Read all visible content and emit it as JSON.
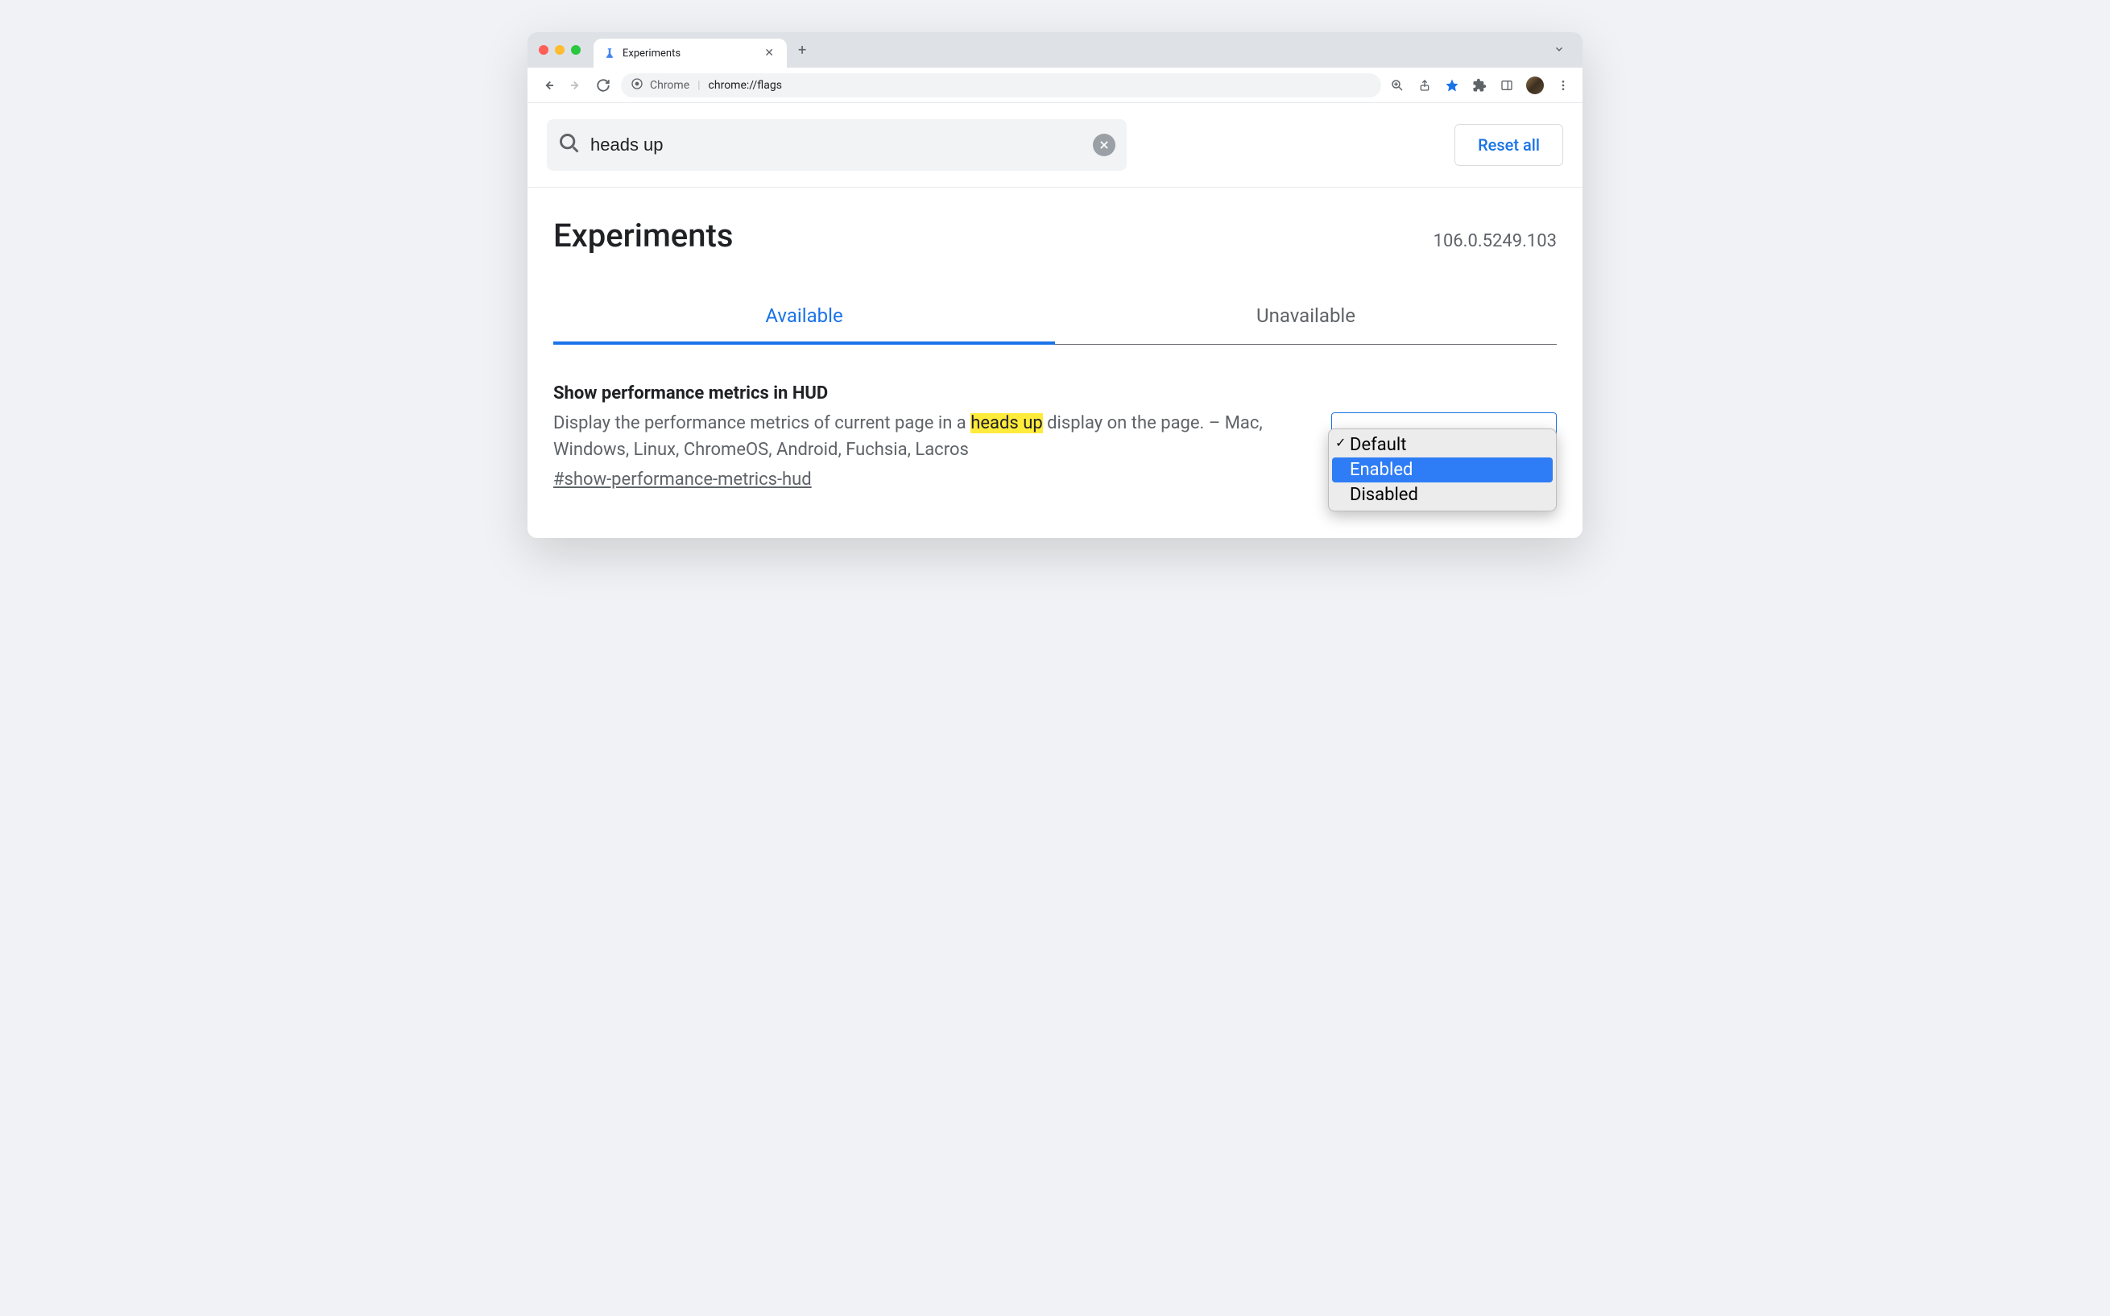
{
  "browser": {
    "tab_title": "Experiments",
    "omnibox_label": "Chrome",
    "omnibox_url": "chrome://flags"
  },
  "search": {
    "value": "heads up"
  },
  "reset_label": "Reset all",
  "header": {
    "title": "Experiments",
    "version": "106.0.5249.103"
  },
  "tabs": {
    "available": "Available",
    "unavailable": "Unavailable"
  },
  "flag": {
    "title": "Show performance metrics in HUD",
    "desc_pre": "Display the performance metrics of current page in a ",
    "desc_highlight": "heads up",
    "desc_post": " display on the page. – Mac, Windows, Linux, ChromeOS, Android, Fuchsia, Lacros",
    "anchor": "#show-performance-metrics-hud"
  },
  "dropdown": {
    "default": "Default",
    "enabled": "Enabled",
    "disabled": "Disabled"
  }
}
